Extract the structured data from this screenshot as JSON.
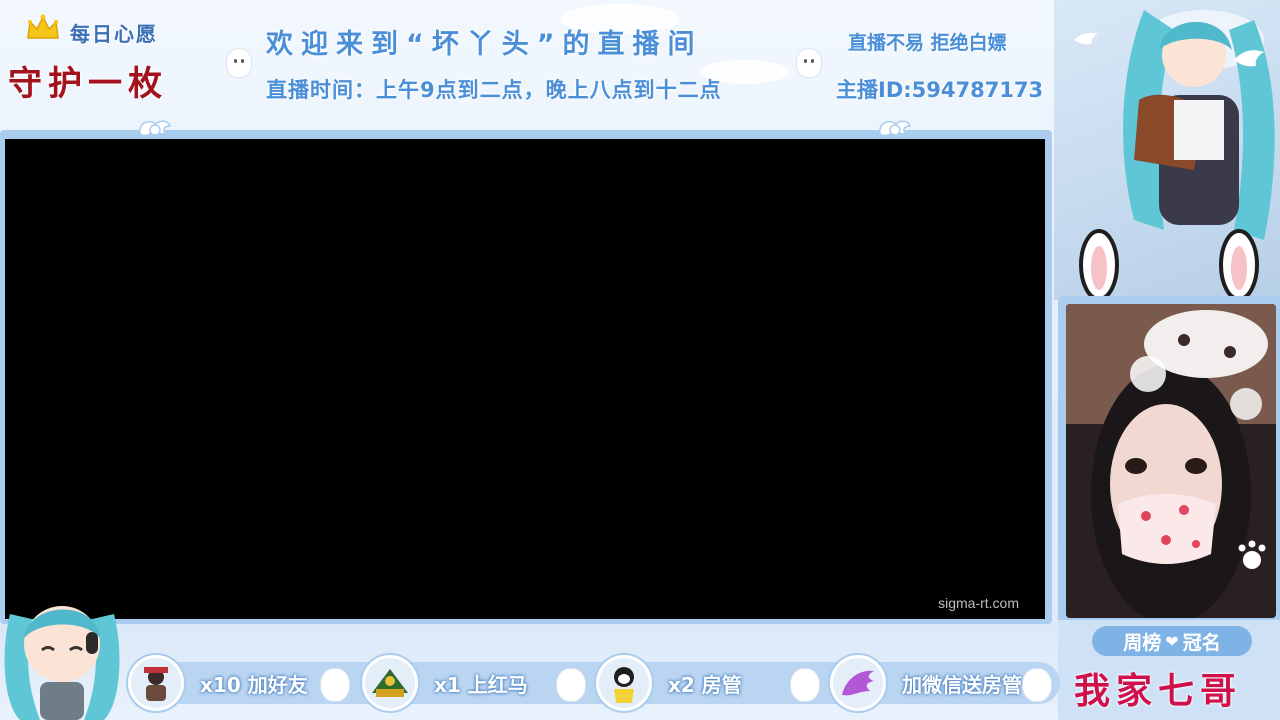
{
  "header": {
    "wish_label": "每日心愿",
    "wish_value": "守护一枚",
    "welcome": "欢迎来到“坏丫头”的直播间",
    "hours": "直播时间：上午9点到二点，晚上八点到十二点",
    "notice": "直播不易 拒绝白嫖",
    "streamer_id": "主播ID:594787173"
  },
  "video": {
    "watermark": "sigma-rt.com"
  },
  "gifts": [
    {
      "text": "x10 加好友",
      "icon": "person-avatar"
    },
    {
      "text": "x1 上红马",
      "icon": "tank-avatar"
    },
    {
      "text": "x2 房管",
      "icon": "penguin-avatar"
    },
    {
      "text": "加微信送房管",
      "icon": "wing-avatar"
    }
  ],
  "ranking": {
    "title_left": "周榜",
    "title_right": "冠名",
    "name": "我家七哥"
  },
  "colors": {
    "accent_blue": "#4a8fd8",
    "frame_blue": "#a9ccef",
    "wish_red": "#a3121d",
    "name_pink": "#d0104a"
  }
}
